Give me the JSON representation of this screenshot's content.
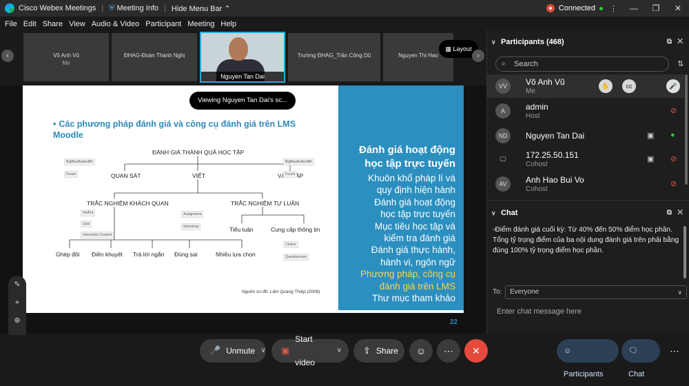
{
  "titlebar": {
    "app": "Cisco Webex Meetings",
    "meeting_info": "Meeting Info",
    "hide_menu": "Hide Menu Bar",
    "status": "Connected"
  },
  "menu": [
    "File",
    "Edit",
    "Share",
    "View",
    "Audio & Video",
    "Participant",
    "Meeting",
    "Help"
  ],
  "filmstrip": {
    "tiles": [
      {
        "name": "Võ Anh Vũ",
        "sub": "Me"
      },
      {
        "name": "ĐHAG-Đoàn Thanh Nghị",
        "sub": ""
      },
      {
        "name": "Nguyen Tan Dai",
        "sub": ""
      },
      {
        "name": "Trường ĐHAG_Trần Công Dũ",
        "sub": ""
      },
      {
        "name": "Nguyen Thi Hao",
        "sub": ""
      }
    ],
    "layout_label": "Layout"
  },
  "viewing_banner": "Viewing Nguyen Tan Dai's sc...",
  "slide": {
    "heading": "Các phương pháp đánh giá và công cụ đánh giá trên LMS Moodle",
    "right_title": "Đánh giá hoạt động học tập trực tuyến",
    "right_lines": [
      "Khuôn khổ pháp lí và",
      "quy định hiện hành",
      "Đánh giá hoạt động",
      "học tập trực tuyến",
      "Mục tiêu học tập và",
      "kiểm tra đánh giá",
      "Đánh giá thực hành,",
      "hành vi, ngôn ngữ"
    ],
    "right_highlight": "Phương pháp, công cụ đánh giá trên LMS",
    "right_last": "Thư mục tham khảo",
    "diagram": {
      "root": "ĐÁNH GIÁ THÀNH QUẢ HỌC TẬP",
      "quan_sat": "QUAN SÁT",
      "viet": "VIẾT",
      "van_dap": "VẤN ĐÁP",
      "tn_khach_quan": "TRẮC NGHIỆM KHÁCH QUAN",
      "tn_tu_luan": "TRẮC NGHIỆM TỰ LUẬN",
      "tieu_luan": "Tiểu luận",
      "cung_cap": "Cung cấp thông tin",
      "leaves": [
        "Ghép đôi",
        "Điền khuyết",
        "Trả lời ngắn",
        "Đúng sai",
        "Nhiều lựa chọn"
      ],
      "boxes": [
        "BigBlueButtonBN",
        "Forum",
        "BigBlueButtonBN",
        "Forum",
        "HotPot",
        "Quiz",
        "Interactive Content",
        "Assignment",
        "Workshop",
        "Choice",
        "Questionnaire"
      ]
    },
    "source": "Nguồn sơ đồ: Lâm Quang Thiệp (2008)",
    "page": "22"
  },
  "participants": {
    "header": "Participants (468)",
    "search_placeholder": "Search",
    "rows": [
      {
        "initials": "VV",
        "name": "Võ Anh Vũ",
        "role": "Me"
      },
      {
        "initials": "A",
        "name": "admin",
        "role": "Host"
      },
      {
        "initials": "ND",
        "name": "Nguyen Tan Dai",
        "role": ""
      },
      {
        "initials": "",
        "name": "172.25.50.151",
        "role": "Cohost"
      },
      {
        "initials": "AV",
        "name": "Anh Hao Bui Vo",
        "role": "Cohost"
      }
    ]
  },
  "chat": {
    "header": "Chat",
    "message": "-Điểm đánh giá cuối kỳ: Từ 40% đến 50% điểm học phần.\nTổng tỷ trọng điểm của ba nội dung đánh giá trên phải bằng đúng 100% tỷ trọng điểm học phần.",
    "to_label": "To:",
    "to_value": "Everyone",
    "input_placeholder": "Enter chat message here"
  },
  "controls": {
    "unmute": "Unmute",
    "start_video": "Start video",
    "share": "Share",
    "participants": "Participants",
    "chat": "Chat"
  },
  "colors": {
    "accent": "#27a9e1",
    "end": "#e54a3c",
    "slide_blue": "#2b8fbf",
    "highlight": "#ffd54a"
  }
}
